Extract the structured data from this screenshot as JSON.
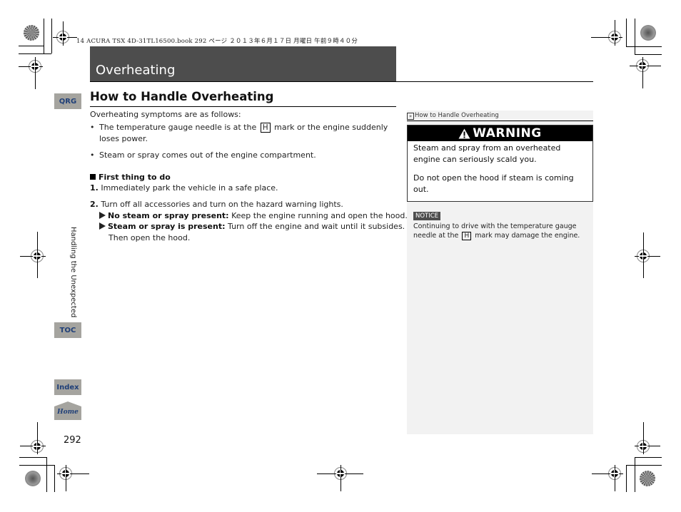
{
  "print_line": "14 ACURA TSX 4D-31TL16500.book  292 ページ  ２０１３年６月１７日  月曜日  午前９時４０分",
  "chapter": {
    "title": "Overheating"
  },
  "nav": {
    "qrg_label": "QRG",
    "toc_label": "TOC",
    "index_label": "Index",
    "home_label": "Home",
    "section_label": "Handling the Unexpected",
    "page_number": "292"
  },
  "main": {
    "section_title": "How to Handle Overheating",
    "intro": "Overheating symptoms are as follows:",
    "symptoms": [
      {
        "before": "The temperature gauge needle is at the",
        "key": "H",
        "after": "mark or the engine suddenly",
        "line2": "loses power."
      },
      {
        "text": "Steam or spray comes out of the engine compartment."
      }
    ],
    "subsection_title": "First thing to do",
    "steps": [
      {
        "num": "1.",
        "text": "Immediately park the vehicle in a safe place."
      },
      {
        "num": "2.",
        "text": "Turn off all accessories and turn on the hazard warning lights."
      }
    ],
    "conditions": [
      {
        "label": "No steam or spray present:",
        "text": "Keep the engine running and open the hood."
      },
      {
        "label": "Steam or spray is present:",
        "text": "Turn off the engine and wait until it subsides.",
        "line2": "Then open the hood."
      }
    ]
  },
  "sidebar": {
    "ref_title": "How to Handle Overheating",
    "warning": {
      "heading": "WARNING",
      "line1": "Steam and spray from an overheated",
      "line2": "engine can seriously scald you.",
      "line3": "Do not open the hood if steam is coming",
      "line4": "out."
    },
    "notice": {
      "badge": "NOTICE",
      "line1": "Continuing to drive with the temperature gauge",
      "line2_before": "needle at the",
      "key": "H",
      "line2_after": "mark may damage the engine."
    }
  },
  "colors": {
    "chapter_bar": "#4d4d4d",
    "tab_bg": "#a5a49f",
    "tab_text": "#1f3f78",
    "sidebar_bg": "#f2f2f2"
  }
}
